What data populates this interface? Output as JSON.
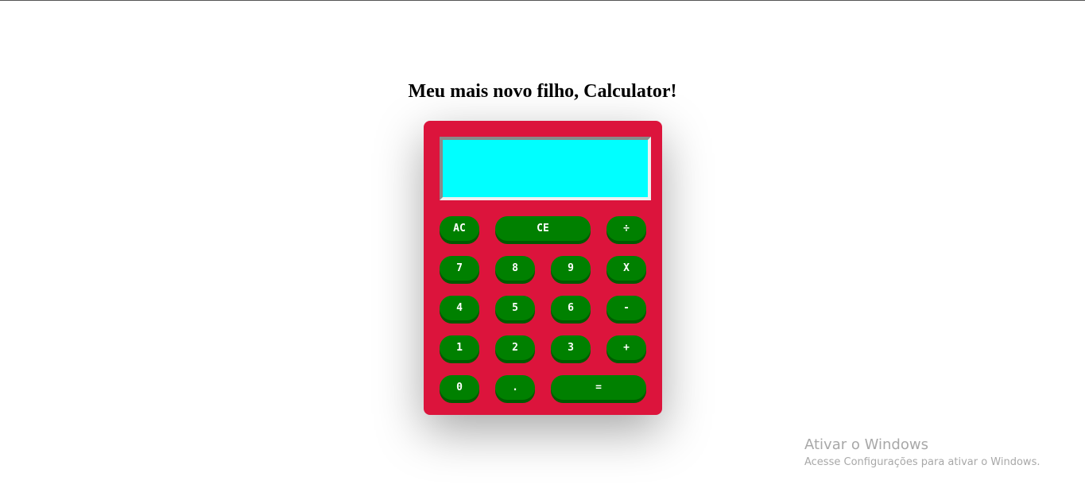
{
  "page": {
    "title": "Meu mais novo filho, Calculator!"
  },
  "calculator": {
    "display_value": "",
    "colors": {
      "body": "#dc143c",
      "display": "#00ffff",
      "button": "#008000",
      "button_text": "#ffffff"
    },
    "buttons": {
      "ac": "AC",
      "ce": "CE",
      "divide": "÷",
      "seven": "7",
      "eight": "8",
      "nine": "9",
      "multiply": "X",
      "four": "4",
      "five": "5",
      "six": "6",
      "minus": "-",
      "one": "1",
      "two": "2",
      "three": "3",
      "plus": "+",
      "zero": "0",
      "dot": ".",
      "equals": "="
    }
  },
  "watermark": {
    "title": "Ativar o Windows",
    "subtitle": "Acesse Configurações para ativar o Windows."
  }
}
